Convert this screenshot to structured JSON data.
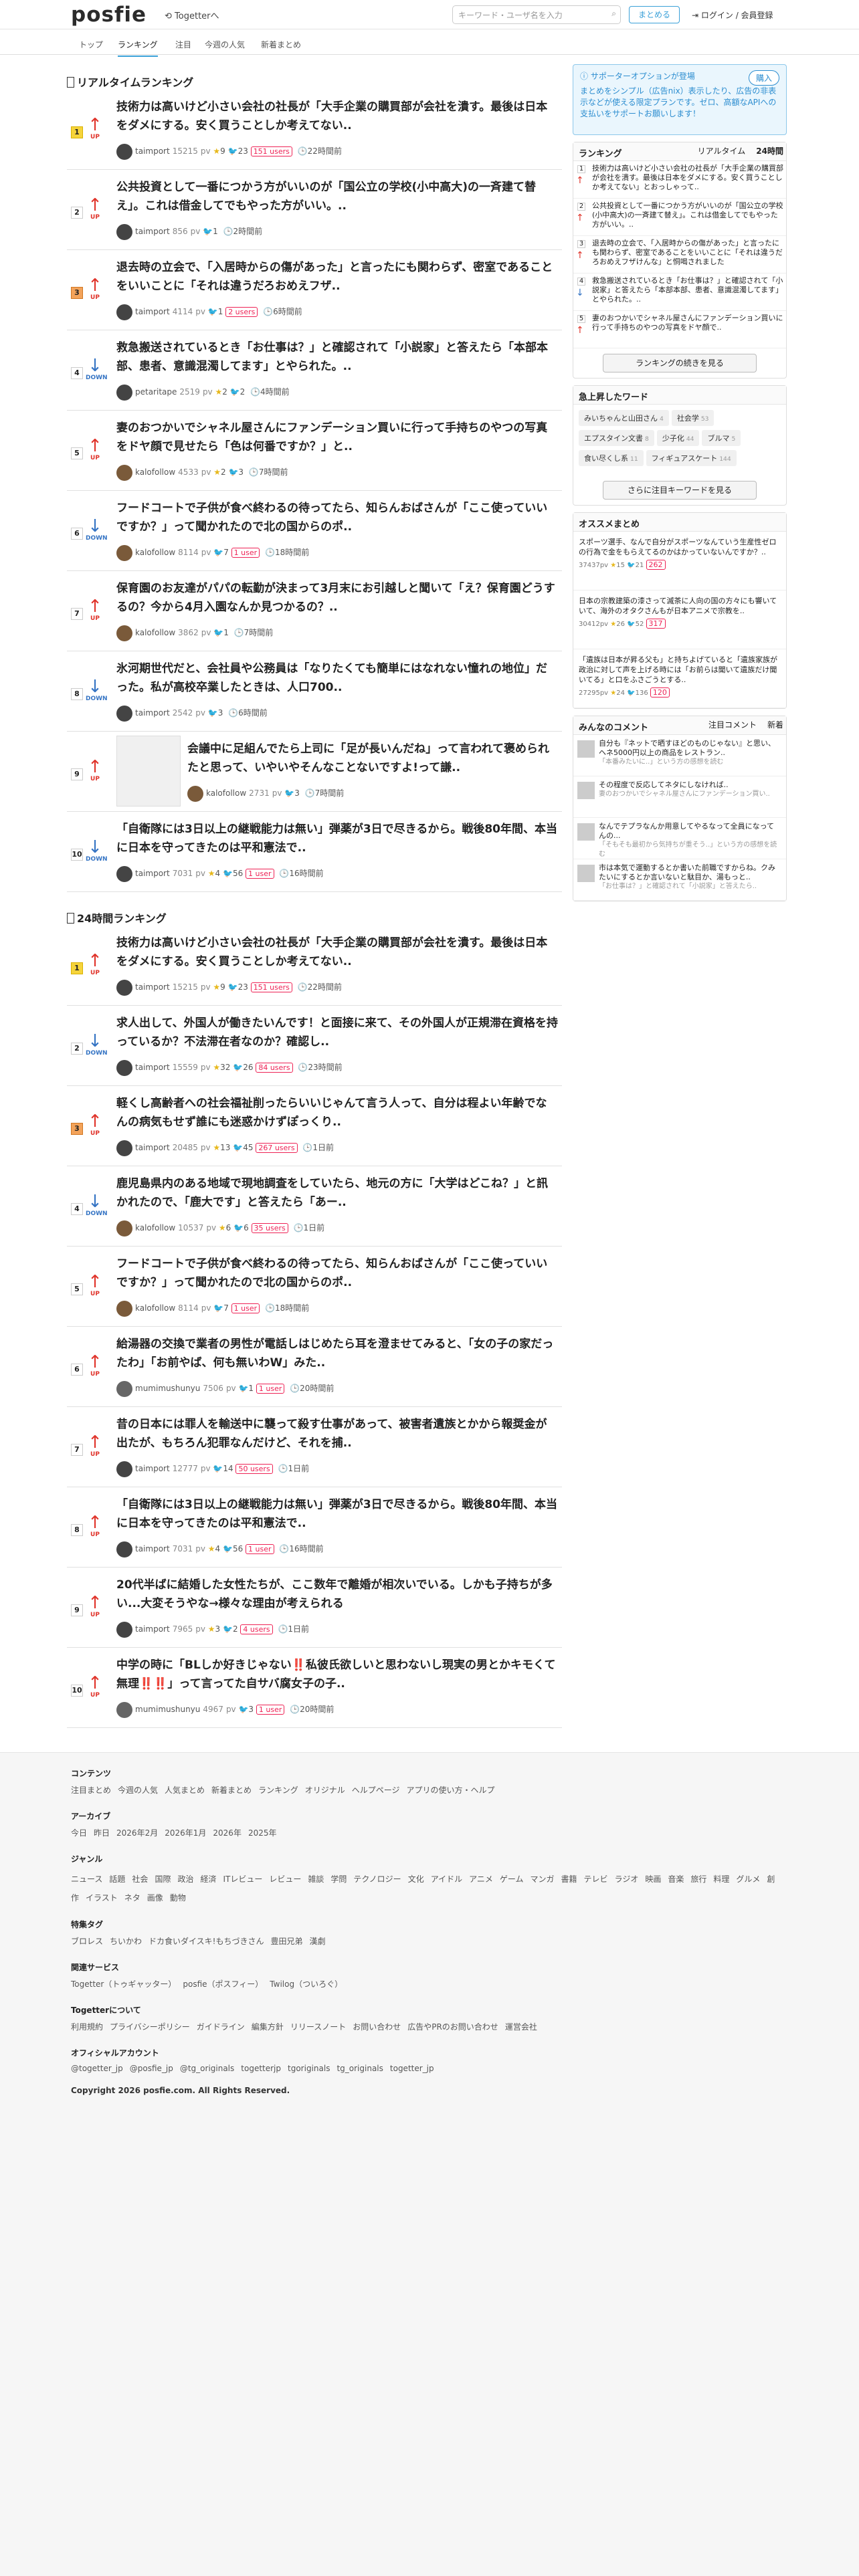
{
  "header": {
    "logo": "posfie",
    "togetter": "Togetterへ",
    "search_placeholder": "キーワード・ユーザ名を入力",
    "summary_btn": "まとめる",
    "login": "ログイン / 会員登録"
  },
  "nav": [
    "トップ",
    "ランキング",
    "注目",
    "今週の人気",
    "新着まとめ"
  ],
  "realtime": {
    "title": "リアルタイムランキング",
    "items": [
      {
        "rank": "1",
        "dir": "UP",
        "title": "技術力は高いけど小さい会社の社長が「大手企業の購買部が会社を潰す。最後は日本をダメにする。安く買うことしか考えてない..",
        "user": "taimport",
        "count": "15215",
        "stars": "9",
        "tw": "23",
        "users": "151 users",
        "time": "22時間前"
      },
      {
        "rank": "2",
        "dir": "UP",
        "title": "公共投資として一番につかう方がいいのが「国公立の学校(小中高大)の一斉建て替え」。これは借金してでもやった方がいい。..",
        "user": "taimport",
        "count": "856",
        "stars": "",
        "tw": "1",
        "users": "",
        "time": "2時間前"
      },
      {
        "rank": "3",
        "dir": "UP",
        "title": "退去時の立会で、「入居時からの傷があった」と言ったにも関わらず、密室であることをいいことに「それは違うだろおめえフザ..",
        "user": "taimport",
        "count": "4114",
        "stars": "",
        "tw": "1",
        "users": "2 users",
        "time": "6時間前"
      },
      {
        "rank": "4",
        "dir": "DOWN",
        "title": "救急搬送されているとき「お仕事は？」と確認されて「小説家」と答えたら「本部本部、患者、意識混濁してます」とやられた。..",
        "user": "petaritape",
        "count": "2519",
        "stars": "2",
        "tw": "2",
        "users": "",
        "time": "4時間前"
      },
      {
        "rank": "5",
        "dir": "UP",
        "title": "妻のおつかいでシャネル屋さんにファンデーション買いに行って手持ちのやつの写真をドヤ顔で見せたら「色は何番ですか？」と..",
        "user": "kalofollow",
        "count": "4533",
        "stars": "2",
        "tw": "3",
        "users": "",
        "time": "7時間前"
      },
      {
        "rank": "6",
        "dir": "DOWN",
        "title": "フードコートで子供が食べ終わるの待ってたら、知らんおばさんが「ここ使っていいですか？」って聞かれたので北の国からのポ..",
        "user": "kalofollow",
        "count": "8114",
        "stars": "",
        "tw": "7",
        "users": "1 user",
        "time": "18時間前"
      },
      {
        "rank": "7",
        "dir": "UP",
        "title": "保育園のお友達がパパの転勤が決まって3月末にお引越しと聞いて「え？保育園どうするの？今から4月入園なんか見つかるの？..",
        "user": "kalofollow",
        "count": "3862",
        "stars": "",
        "tw": "1",
        "users": "",
        "time": "7時間前"
      },
      {
        "rank": "8",
        "dir": "DOWN",
        "title": "氷河期世代だと、会社員や公務員は「なりたくても簡単にはなれない憧れの地位」だった。私が高校卒業したときは、人口700..",
        "user": "taimport",
        "count": "2542",
        "stars": "",
        "tw": "3",
        "users": "",
        "time": "6時間前"
      },
      {
        "rank": "9",
        "dir": "UP",
        "title": "会議中に足組んでたら上司に「足が長いんだね」って言われて褒められたと思って、いやいやそんなことないですよ!って謙..",
        "user": "kalofollow",
        "count": "2731",
        "stars": "",
        "tw": "3",
        "users": "",
        "time": "7時間前"
      },
      {
        "rank": "10",
        "dir": "DOWN",
        "title": "「自衛隊には3日以上の継戦能力は無い」弾薬が3日で尽きるから。戦後80年間、本当に日本を守ってきたのは平和憲法で..",
        "user": "taimport",
        "count": "7031",
        "stars": "4",
        "tw": "56",
        "users": "1 user",
        "time": "16時間前"
      }
    ]
  },
  "daily": {
    "title": "24時間ランキング",
    "items": [
      {
        "rank": "1",
        "dir": "UP",
        "title": "技術力は高いけど小さい会社の社長が「大手企業の購買部が会社を潰す。最後は日本をダメにする。安く買うことしか考えてない..",
        "user": "taimport",
        "count": "15215",
        "stars": "9",
        "tw": "23",
        "users": "151 users",
        "time": "22時間前"
      },
      {
        "rank": "2",
        "dir": "DOWN",
        "title": "求人出して、外国人が働きたいんです！と面接に来て、その外国人が正規滞在資格を持っているか？不法滞在者なのか？確認し..",
        "user": "taimport",
        "count": "15559",
        "stars": "32",
        "tw": "26",
        "users": "84 users",
        "time": "23時間前"
      },
      {
        "rank": "3",
        "dir": "UP",
        "title": "軽くし高齢者への社会福祉削ったらいいじゃんて言う人って、自分は程よい年齢でなんの病気もせず誰にも迷惑かけずぽっくり..",
        "user": "taimport",
        "count": "20485",
        "stars": "13",
        "tw": "45",
        "users": "267 users",
        "time": "1日前"
      },
      {
        "rank": "4",
        "dir": "DOWN",
        "title": "鹿児島県内のある地域で現地調査をしていたら、地元の方に「大学はどこね？」と訊かれたので、「鹿大です」と答えたら「あー..",
        "user": "kalofollow",
        "count": "10537",
        "stars": "6",
        "tw": "6",
        "users": "35 users",
        "time": "1日前"
      },
      {
        "rank": "5",
        "dir": "UP",
        "title": "フードコートで子供が食べ終わるの待ってたら、知らんおばさんが「ここ使っていいですか？」って聞かれたので北の国からのポ..",
        "user": "kalofollow",
        "count": "8114",
        "stars": "",
        "tw": "7",
        "users": "1 user",
        "time": "18時間前"
      },
      {
        "rank": "6",
        "dir": "UP",
        "title": "給湯器の交換で業者の男性が電話しはじめたら耳を澄ませてみると、「女の子の家だったわ」「お前やば、何も無いわW」みた..",
        "user": "mumimushunyu",
        "count": "7506",
        "stars": "",
        "tw": "1",
        "users": "1 user",
        "time": "20時間前"
      },
      {
        "rank": "7",
        "dir": "UP",
        "title": "昔の日本には罪人を輸送中に襲って殺す仕事があって、被害者遺族とかから報奨金が出たが、もちろん犯罪なんだけど、それを捕..",
        "user": "taimport",
        "count": "12777",
        "stars": "",
        "tw": "14",
        "users": "50 users",
        "time": "1日前"
      },
      {
        "rank": "8",
        "dir": "UP",
        "title": "「自衛隊には3日以上の継戦能力は無い」弾薬が3日で尽きるから。戦後80年間、本当に日本を守ってきたのは平和憲法で..",
        "user": "taimport",
        "count": "7031",
        "stars": "4",
        "tw": "56",
        "users": "1 user",
        "time": "16時間前"
      },
      {
        "rank": "9",
        "dir": "UP",
        "title": "20代半ばに結婚した女性たちが、ここ数年で離婚が相次いでいる。しかも子持ちが多い...大変そうやな→様々な理由が考えられる",
        "user": "taimport",
        "count": "7965",
        "stars": "3",
        "tw": "2",
        "users": "4 users",
        "time": "1日前"
      },
      {
        "rank": "10",
        "dir": "UP",
        "title": "中学の時に「BLしか好きじゃない‼️私彼氏欲しいと思わないし現実の男とかキモくて無理‼️‼️」って言ってた自サバ腐女子の子..",
        "user": "mumimushunyu",
        "count": "4967",
        "stars": "",
        "tw": "3",
        "users": "1 user",
        "time": "20時間前"
      }
    ]
  },
  "sidebar": {
    "ad_title": "サポーターオプションが登場",
    "ad_buy": "購入",
    "ad_desc": "まとめをシンプル（広告nix）表示したり、広告の非表示などが使える限定プランです。ゼロ、高額なAPIへの支払いをサポートお願いします！",
    "rank_title": "ランキング",
    "rank_tabs": [
      "リアルタイム",
      "24時間"
    ],
    "rank_items": [
      {
        "n": "1",
        "t": "技術力は高いけど小さい会社の社長が「大手企業の購買部が会社を潰す。最後は日本をダメにする。安く買うことしか考えてない」とおっしゃって.."
      },
      {
        "n": "2",
        "t": "公共投資として一番につかう方がいいのが「国公立の学校(小中高大)の一斉建て替え」。これは借金してでもやった方がいい。.."
      },
      {
        "n": "3",
        "t": "退去時の立会で、「入居時からの傷があった」と言ったにも関わらず、密室であることをいいことに「それは違うだろおめえフザけんな」と恫喝されました"
      },
      {
        "n": "4",
        "t": "救急搬送されているとき「お仕事は？」と確認されて「小説家」と答えたら「本部本部、患者、意識混濁してます」とやられた。.."
      },
      {
        "n": "5",
        "t": "妻のおつかいでシャネル屋さんにファンデーション買いに行って手持ちのやつの写真をドヤ顔で.."
      }
    ],
    "rank_more": "ランキングの続きを見る",
    "kw_title": "急上昇したワード",
    "keywords": [
      "みいちゃんと山田さん",
      "社会学",
      "エプスタイン文書",
      "少子化",
      "ブルマ",
      "食い尽くし系",
      "フィギュアスケート"
    ],
    "kw_counts": [
      "4",
      "53",
      "8",
      "44",
      "5",
      "11",
      "144"
    ],
    "kw_more": "さらに注目キーワードを見る",
    "os_title": "オススメまとめ",
    "os_items": [
      {
        "t": "スポーツ選手、なんで自分がスポーツなんていう生産性ゼロの行為で金をもらえてるのかはかっていないんですか？..",
        "count": "37437",
        "stars": "15",
        "tw": "21",
        "users": "262"
      },
      {
        "t": "日本の宗教建築の漆さって滅茶に人向の国の方々にも響いていて、海外のオタクさんもが日本アニメで宗教を..",
        "count": "30412",
        "stars": "26",
        "tw": "52",
        "users": "317"
      },
      {
        "t": "「遺族は日本が昇る父も」と持ちよげていると「遺族家族が政治に対して声を上げる時には「お前らは聞いて遺族だけ聞いてる」と口をふさごうとする..",
        "count": "27295",
        "stars": "24",
        "tw": "136",
        "users": "120"
      }
    ],
    "cm_title": "みんなのコメント",
    "cm_tabs": [
      "注目コメント",
      "新着"
    ],
    "comments": [
      {
        "t": "自分も『ネットで晒すほどのものじゃない』と思い、ヘネ5000円以上の商品をレストラン..",
        "c": "「本番みたいに..」という方の感想を読む"
      },
      {
        "t": "その程度で反応してネタにしなければ..",
        "c": "妻のおつかいでシャネル屋さんにファンデーション買い.."
      },
      {
        "t": "なんでテプラなんか用意してやるなって全員になってんの...",
        "c": "「そもそも最初から気持ちが重そう..」という方の感想を読む"
      },
      {
        "t": "市は本気で運動するとか書いた前職ですからね。クみたいにするとか言いないと駄目か、湯もっと..",
        "c": "「お仕事は？」と確認されて「小説家」と答えたら.."
      }
    ]
  },
  "footer": {
    "contents_h": "コンテンツ",
    "contents": [
      "注目まとめ",
      "今週の人気",
      "人気まとめ",
      "新着まとめ",
      "ランキング",
      "オリジナル",
      "ヘルプページ",
      "アプリの使い方・ヘルプ"
    ],
    "archive_h": "アーカイブ",
    "archive": [
      "今日",
      "昨日",
      "2026年2月",
      "2026年1月",
      "2026年",
      "2025年"
    ],
    "genre_h": "ジャンル",
    "genre": [
      "ニュース",
      "話題",
      "社会",
      "国際",
      "政治",
      "経済",
      "ITレビュー",
      "レビュー",
      "雑談",
      "学問",
      "テクノロジー",
      "文化",
      "アイドル",
      "アニメ",
      "ゲーム",
      "マンガ",
      "書籍",
      "テレビ",
      "ラジオ",
      "映画",
      "音楽",
      "旅行",
      "料理",
      "グルメ",
      "創作",
      "イラスト",
      "ネタ",
      "画像",
      "動物"
    ],
    "tag_h": "特集タグ",
    "tags": [
      "ブロレス",
      "ちいかわ",
      "ドカ食いダイスキ!もちづきさん",
      "豊田兄弟",
      "漢劇"
    ],
    "related_h": "関連サービス",
    "related": [
      "Togetter（トゥギャッター）",
      "posfie（ポスフィー）",
      "Twilog（ついろぐ）"
    ],
    "about_h": "Togetterについて",
    "about": [
      "利用規約",
      "プライバシーポリシー",
      "ガイドライン",
      "編集方針",
      "リリースノート",
      "お問い合わせ",
      "広告やPRのお問い合わせ",
      "運営会社"
    ],
    "official_h": "オフィシャルアカウント",
    "official": [
      "@togetter_jp",
      "@posfie_jp",
      "@tg_originals",
      "togetterjp",
      "tgoriginals",
      "tg_originals",
      "togetter_jp"
    ],
    "copyright": "Copyright 2026 posfie.com. All Rights Reserved."
  }
}
